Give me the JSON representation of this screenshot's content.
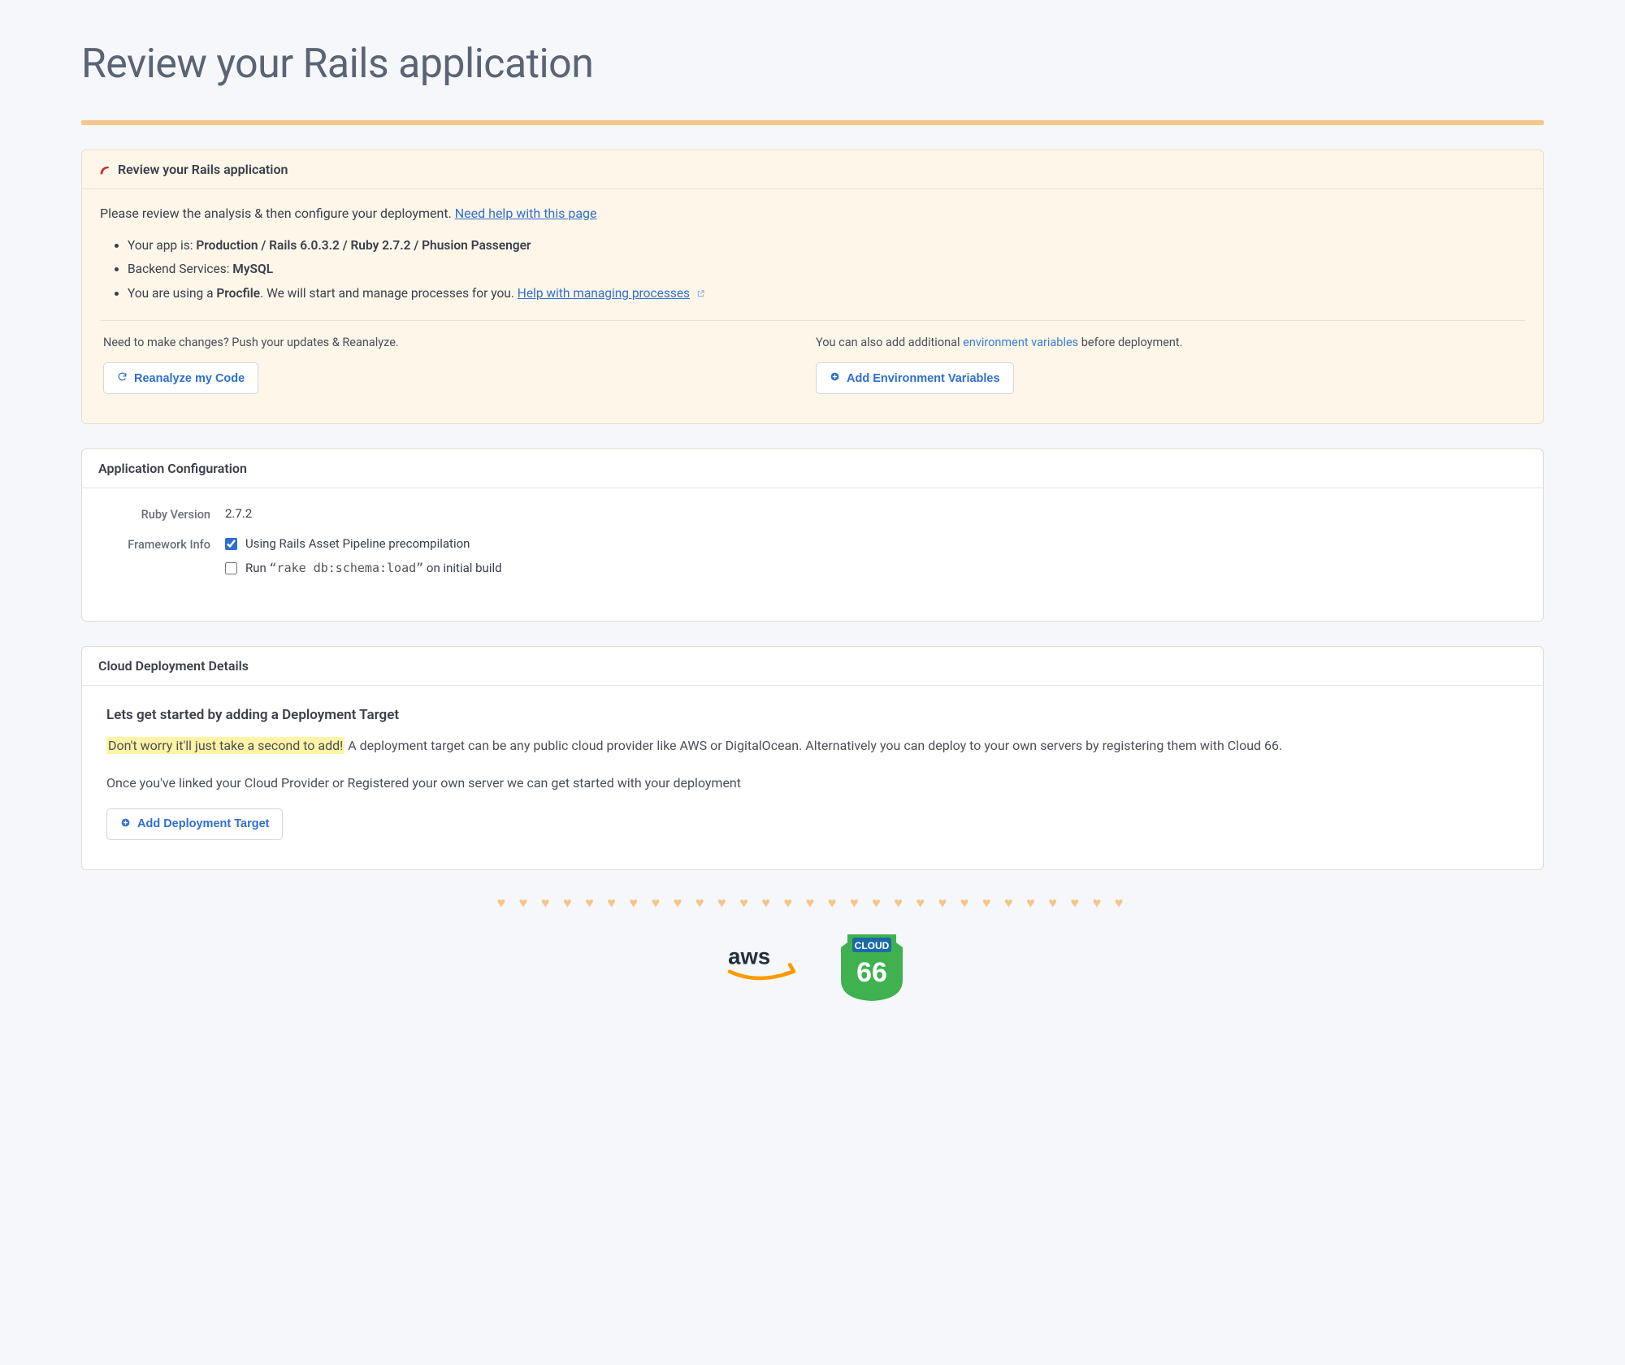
{
  "page_title": "Review your Rails application",
  "review_panel": {
    "header": "Review your Rails application",
    "intro_prefix": "Please review the analysis & then configure your deployment. ",
    "intro_link": "Need help with this page",
    "bullets": {
      "app_prefix": "Your app is: ",
      "app_value": "Production / Rails 6.0.3.2 / Ruby 2.7.2 / Phusion Passenger",
      "backend_prefix": "Backend Services: ",
      "backend_value": "MySQL",
      "procfile_prefix": "You are using a ",
      "procfile_bold": "Procfile",
      "procfile_suffix": ". We will start and manage processes for you. ",
      "procfile_link": "Help with managing processes"
    },
    "actions": {
      "reanalyze_hint": "Need to make changes? Push your updates & Reanalyze.",
      "reanalyze_btn": "Reanalyze my Code",
      "env_hint_prefix": "You can also add additional ",
      "env_hint_link": "environment variables",
      "env_hint_suffix": " before deployment.",
      "env_btn": "Add Environment Variables"
    }
  },
  "config_panel": {
    "header": "Application Configuration",
    "ruby_label": "Ruby Version",
    "ruby_value": "2.7.2",
    "framework_label": "Framework Info",
    "check1": "Using Rails Asset Pipeline precompilation",
    "check2_prefix": "Run ",
    "check2_code": "“rake db:schema:load”",
    "check2_suffix": " on initial build"
  },
  "deploy_panel": {
    "header": "Cloud Deployment Details",
    "heading": "Lets get started by adding a Deployment Target",
    "p1_highlight": "Don't worry it'll just take a second to add!",
    "p1_rest": " A deployment target can be any public cloud provider like AWS or DigitalOcean. Alternatively you can deploy to your own servers by registering them with Cloud 66.",
    "p2": "Once you've linked your Cloud Provider or Registered your own server we can get started with your deployment",
    "btn": "Add Deployment Target"
  },
  "hearts": "♥ ♥ ♥ ♥ ♥ ♥ ♥ ♥ ♥ ♥ ♥ ♥ ♥ ♥ ♥ ♥ ♥ ♥ ♥ ♥ ♥ ♥ ♥ ♥ ♥ ♥ ♥ ♥ ♥"
}
